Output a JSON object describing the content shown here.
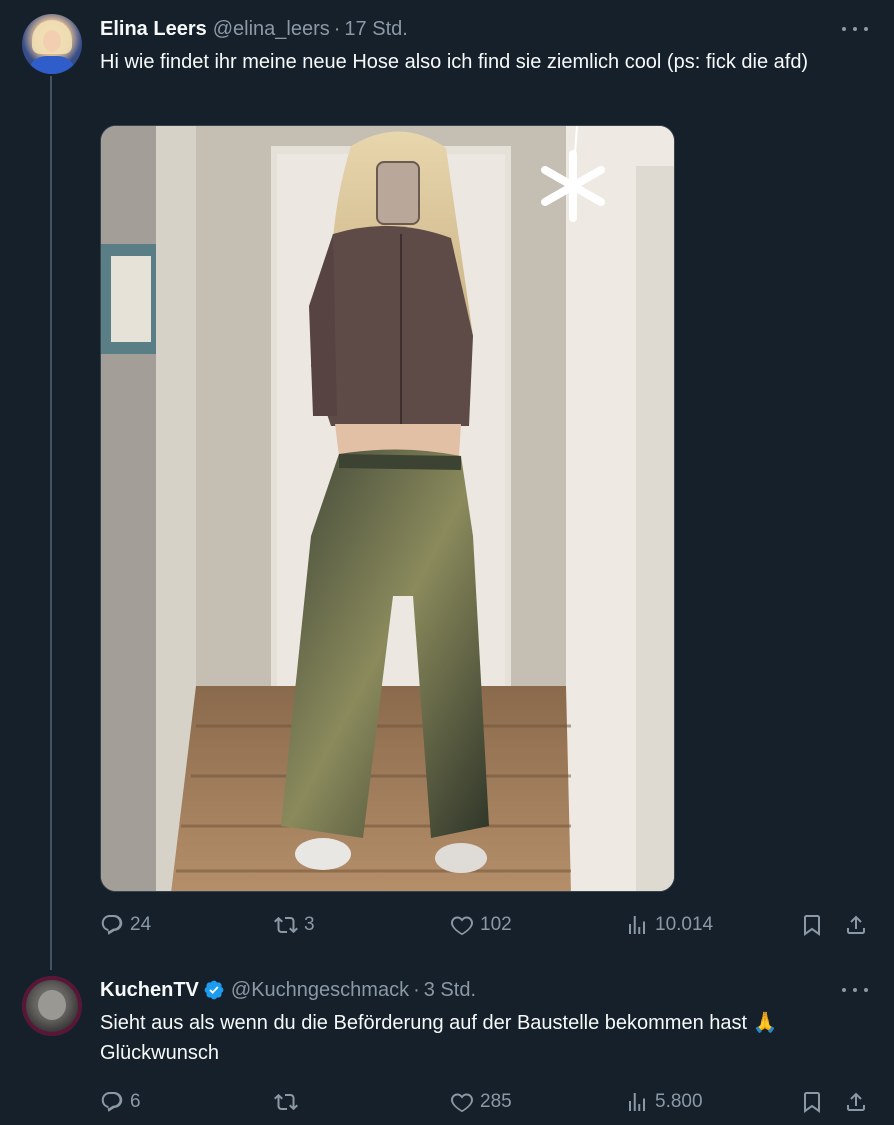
{
  "tweets": [
    {
      "name": "Elina Leers",
      "handle": "@elina_leers",
      "separator": "·",
      "time": "17 Std.",
      "text": "Hi wie findet ihr meine neue Hose also ich find sie ziemlich cool (ps: fick die afd)",
      "stats": {
        "replies": "24",
        "retweets": "3",
        "likes": "102",
        "views": "10.014"
      }
    },
    {
      "name": "KuchenTV",
      "verified": true,
      "handle": "@Kuchngeschmack",
      "separator": "·",
      "time": "3 Std.",
      "text": "Sieht aus als wenn du die Beförderung auf der Baustelle bekommen hast 🙏 Glückwunsch",
      "stats": {
        "replies": "6",
        "retweets": "",
        "likes": "285",
        "views": "5.800"
      }
    }
  ],
  "icons": [
    "reply-icon",
    "retweet-icon",
    "like-icon",
    "views-icon",
    "bookmark-icon",
    "share-icon",
    "more-icon",
    "verified-icon"
  ],
  "colors": {
    "background": "#15202b",
    "text": "#f7f9f9",
    "muted": "#8b98a5",
    "verified": "#1d9bf0",
    "thread_line": "#425364"
  }
}
